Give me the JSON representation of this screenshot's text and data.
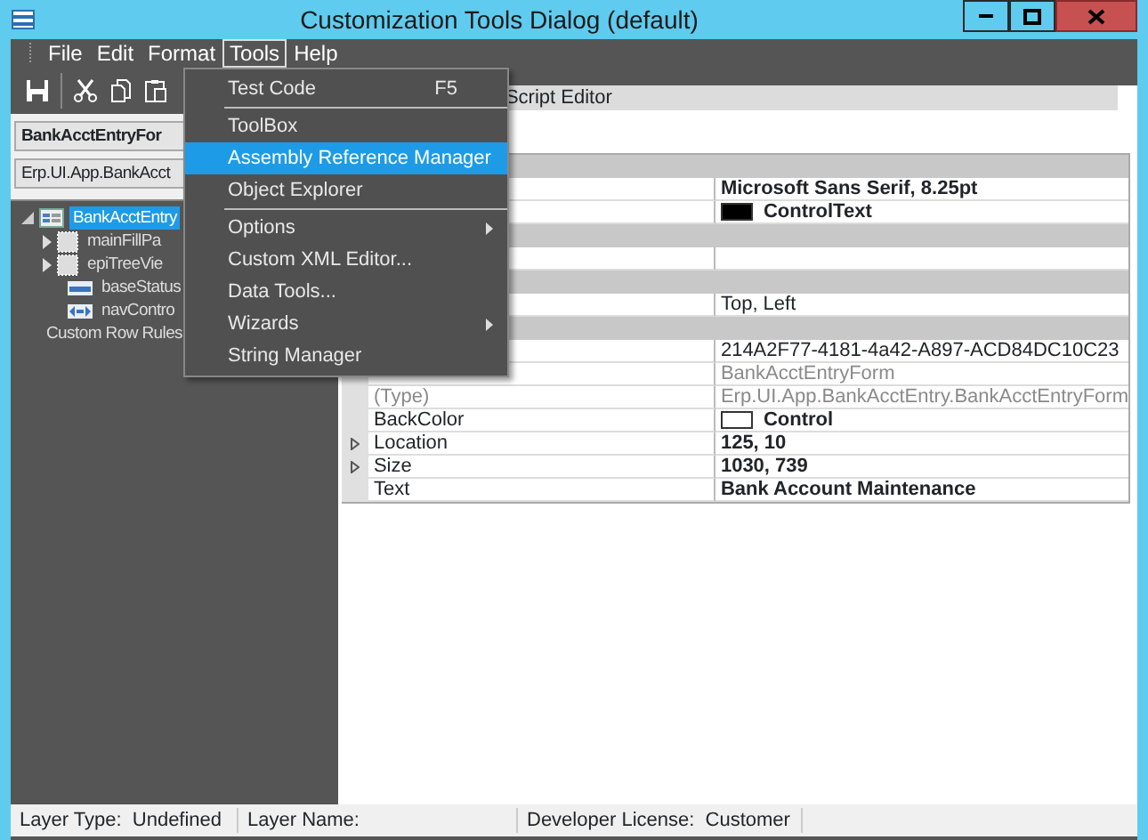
{
  "window": {
    "title": "Customization Tools Dialog (default)"
  },
  "menu_bar": [
    {
      "label": "File",
      "selected": false
    },
    {
      "label": "Edit",
      "selected": false
    },
    {
      "label": "Format",
      "selected": false
    },
    {
      "label": "Tools",
      "selected": true
    },
    {
      "label": "Help",
      "selected": false
    }
  ],
  "tools_menu": [
    {
      "kind": "item",
      "label": "Test Code",
      "shortcut": "F5",
      "selected": false,
      "submenu": false
    },
    {
      "kind": "separator"
    },
    {
      "kind": "item",
      "label": "ToolBox",
      "selected": false,
      "submenu": false
    },
    {
      "kind": "item",
      "label": "Assembly Reference Manager",
      "selected": true,
      "submenu": false
    },
    {
      "kind": "item",
      "label": "Object Explorer",
      "selected": false,
      "submenu": false
    },
    {
      "kind": "separator"
    },
    {
      "kind": "item",
      "label": "Options",
      "selected": false,
      "submenu": true
    },
    {
      "kind": "item",
      "label": "Custom XML Editor...",
      "selected": false,
      "submenu": false
    },
    {
      "kind": "item",
      "label": "Data Tools...",
      "selected": false,
      "submenu": false
    },
    {
      "kind": "item",
      "label": "Wizards",
      "selected": false,
      "submenu": true
    },
    {
      "kind": "item",
      "label": "String Manager",
      "selected": false,
      "submenu": false
    }
  ],
  "left_panel": {
    "form_name": "BankAcctEntryFor",
    "form_type": "Erp.UI.App.BankAcct",
    "tree": [
      {
        "label": "BankAcctEntry",
        "kind": "form",
        "selected": true,
        "expanded": true,
        "children": [
          {
            "label": "mainFillPa",
            "kind": "panel",
            "selected": false,
            "expanded": false
          },
          {
            "label": "epiTreeVie",
            "kind": "panel",
            "selected": false,
            "expanded": false
          },
          {
            "label": "baseStatus",
            "kind": "status",
            "selected": false
          },
          {
            "label": "navContro",
            "kind": "nav",
            "selected": false
          }
        ]
      },
      {
        "label": "Custom Row Rules",
        "kind": "plain",
        "selected": false
      }
    ]
  },
  "tab_strip": {
    "label": "Script Editor"
  },
  "property_grid": [
    {
      "kind": "category"
    },
    {
      "kind": "property",
      "value": "Microsoft Sans Serif, 8.25pt",
      "bold": true
    },
    {
      "kind": "property",
      "value": "ControlText",
      "bold": true,
      "color": "#000000"
    },
    {
      "kind": "category"
    },
    {
      "kind": "property"
    },
    {
      "kind": "category"
    },
    {
      "kind": "property",
      "value": "Top, Left",
      "bold": false
    },
    {
      "kind": "category"
    },
    {
      "kind": "property",
      "value": "214A2F77-4181-4a42-A897-ACD84DC10C23",
      "bold": false
    },
    {
      "kind": "property",
      "value": "BankAcctEntryForm",
      "bold": false,
      "disabled": true
    },
    {
      "kind": "property",
      "name": "(Type)",
      "value": "Erp.UI.App.BankAcctEntry.BankAcctEntryForm",
      "bold": false,
      "disabled": true
    },
    {
      "kind": "property",
      "name": "BackColor",
      "value": "Control",
      "bold": true,
      "color": "#ffffff"
    },
    {
      "kind": "property",
      "name": "Location",
      "value": "125, 10",
      "bold": true,
      "expandable": true
    },
    {
      "kind": "property",
      "name": "Size",
      "value": "1030, 739",
      "bold": true,
      "expandable": true
    },
    {
      "kind": "property",
      "name": "Text",
      "value": "Bank Account Maintenance",
      "bold": true
    }
  ],
  "status_bar": [
    {
      "label": "Layer Type:",
      "value": "Undefined"
    },
    {
      "label": "Layer Name:"
    },
    {
      "label": "Developer License:",
      "value": "Customer"
    }
  ]
}
